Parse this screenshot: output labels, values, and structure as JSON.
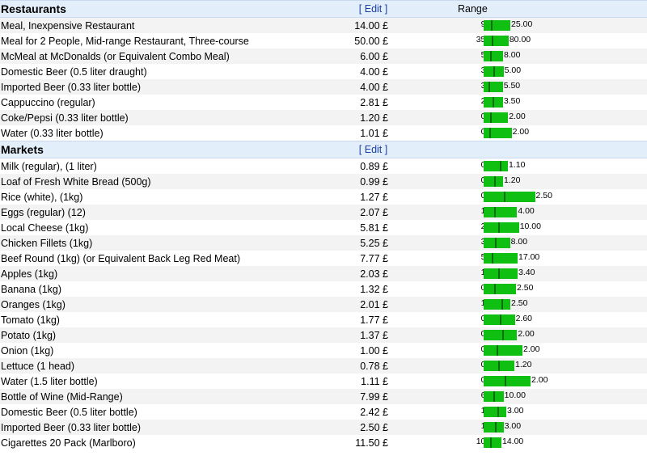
{
  "edit_label": "[ Edit ]",
  "range_label": "Range",
  "currency": "£",
  "colors": {
    "bar": "#0fbf12",
    "tick": "#0a6e0c",
    "header_bg": "#e3eefb"
  },
  "sections": [
    {
      "name": "Restaurants",
      "show_range_label": true,
      "items": [
        {
          "label": "Meal, Inexpensive Restaurant",
          "price": "14.00 £",
          "low": "9.99",
          "high": "25.00",
          "lo_v": 9.99,
          "hi_v": 25.0,
          "avg_v": 14.0
        },
        {
          "label": "Meal for 2 People, Mid-range Restaurant, Three-course",
          "price": "50.00 £",
          "low": "35.00",
          "high": "80.00",
          "lo_v": 35,
          "hi_v": 80,
          "avg_v": 50
        },
        {
          "label": "McMeal at McDonalds (or Equivalent Combo Meal)",
          "price": "6.00 £",
          "low": "5.00",
          "high": "8.00",
          "lo_v": 5,
          "hi_v": 8,
          "avg_v": 6
        },
        {
          "label": "Domestic Beer (0.5 liter draught)",
          "price": "4.00 £",
          "low": "3.00",
          "high": "5.00",
          "lo_v": 3,
          "hi_v": 5,
          "avg_v": 4
        },
        {
          "label": "Imported Beer (0.33 liter bottle)",
          "price": "4.00 £",
          "low": "3.50",
          "high": "5.50",
          "lo_v": 3.5,
          "hi_v": 5.5,
          "avg_v": 4
        },
        {
          "label": "Cappuccino (regular)",
          "price": "2.81 £",
          "low": "2.20",
          "high": "3.50",
          "lo_v": 2.2,
          "hi_v": 3.5,
          "avg_v": 2.81
        },
        {
          "label": "Coke/Pepsi (0.33 liter bottle)",
          "price": "1.20 £",
          "low": "0.90",
          "high": "2.00",
          "lo_v": 0.9,
          "hi_v": 2.0,
          "avg_v": 1.2
        },
        {
          "label": "Water (0.33 liter bottle)",
          "price": "1.01 £",
          "low": "0.75",
          "high": "2.00",
          "lo_v": 0.75,
          "hi_v": 2.0,
          "avg_v": 1.01
        }
      ]
    },
    {
      "name": "Markets",
      "show_range_label": false,
      "items": [
        {
          "label": "Milk (regular), (1 liter)",
          "price": "0.89 £",
          "low": "0.50",
          "high": "1.10",
          "lo_v": 0.5,
          "hi_v": 1.1,
          "avg_v": 0.89
        },
        {
          "label": "Loaf of Fresh White Bread (500g)",
          "price": "0.99 £",
          "low": "0.75",
          "high": "1.20",
          "lo_v": 0.75,
          "hi_v": 1.2,
          "avg_v": 0.99
        },
        {
          "label": "Rice (white), (1kg)",
          "price": "1.27 £",
          "low": "0.45",
          "high": "2.50",
          "lo_v": 0.45,
          "hi_v": 2.5,
          "avg_v": 1.27
        },
        {
          "label": "Eggs (regular) (12)",
          "price": "2.07 £",
          "low": "1.20",
          "high": "4.00",
          "lo_v": 1.2,
          "hi_v": 4.0,
          "avg_v": 2.07
        },
        {
          "label": "Local Cheese (1kg)",
          "price": "5.81 £",
          "low": "2.80",
          "high": "10.00",
          "lo_v": 2.8,
          "hi_v": 10.0,
          "avg_v": 5.81
        },
        {
          "label": "Chicken Fillets (1kg)",
          "price": "5.25 £",
          "low": "3.25",
          "high": "8.00",
          "lo_v": 3.25,
          "hi_v": 8.0,
          "avg_v": 5.25
        },
        {
          "label": "Beef Round (1kg) (or Equivalent Back Leg Red Meat)",
          "price": "7.77 £",
          "low": "5.00",
          "high": "17.00",
          "lo_v": 5,
          "hi_v": 17,
          "avg_v": 7.77
        },
        {
          "label": "Apples (1kg)",
          "price": "2.03 £",
          "low": "1.00",
          "high": "3.40",
          "lo_v": 1.0,
          "hi_v": 3.4,
          "avg_v": 2.03
        },
        {
          "label": "Banana (1kg)",
          "price": "1.32 £",
          "low": "0.78",
          "high": "2.50",
          "lo_v": 0.78,
          "hi_v": 2.5,
          "avg_v": 1.32
        },
        {
          "label": "Oranges (1kg)",
          "price": "2.01 £",
          "low": "1.00",
          "high": "2.50",
          "lo_v": 1.0,
          "hi_v": 2.5,
          "avg_v": 2.01
        },
        {
          "label": "Tomato (1kg)",
          "price": "1.77 £",
          "low": "0.85",
          "high": "2.60",
          "lo_v": 0.85,
          "hi_v": 2.6,
          "avg_v": 1.77
        },
        {
          "label": "Potato (1kg)",
          "price": "1.37 £",
          "low": "0.60",
          "high": "2.00",
          "lo_v": 0.6,
          "hi_v": 2.0,
          "avg_v": 1.37
        },
        {
          "label": "Onion (1kg)",
          "price": "1.00 £",
          "low": "0.50",
          "high": "2.00",
          "lo_v": 0.5,
          "hi_v": 2.0,
          "avg_v": 1.0
        },
        {
          "label": "Lettuce (1 head)",
          "price": "0.78 £",
          "low": "0.40",
          "high": "1.20",
          "lo_v": 0.4,
          "hi_v": 1.2,
          "avg_v": 0.78
        },
        {
          "label": "Water (1.5 liter bottle)",
          "price": "1.11 £",
          "low": "0.40",
          "high": "2.00",
          "lo_v": 0.4,
          "hi_v": 2.0,
          "avg_v": 1.11
        },
        {
          "label": "Bottle of Wine (Mid-Range)",
          "price": "7.99 £",
          "low": "6.00",
          "high": "10.00",
          "lo_v": 6,
          "hi_v": 10,
          "avg_v": 7.99
        },
        {
          "label": "Domestic Beer (0.5 liter bottle)",
          "price": "2.42 £",
          "low": "1.50",
          "high": "3.00",
          "lo_v": 1.5,
          "hi_v": 3.0,
          "avg_v": 2.42
        },
        {
          "label": "Imported Beer (0.33 liter bottle)",
          "price": "2.50 £",
          "low": "1.80",
          "high": "3.00",
          "lo_v": 1.8,
          "hi_v": 3.0,
          "avg_v": 2.5
        },
        {
          "label": "Cigarettes 20 Pack (Marlboro)",
          "price": "11.50 £",
          "low": "10.00",
          "high": "14.00",
          "lo_v": 10,
          "hi_v": 14,
          "avg_v": 11.5
        }
      ]
    }
  ]
}
